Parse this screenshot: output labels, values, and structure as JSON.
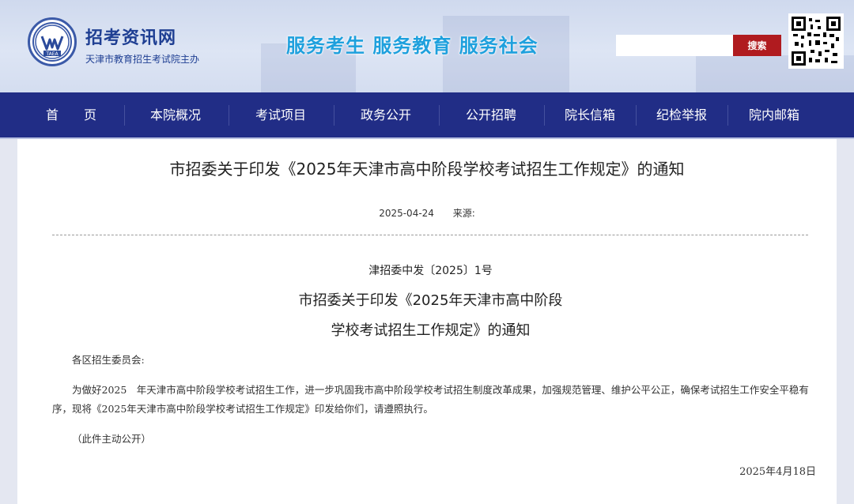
{
  "header": {
    "site_name": "招考资讯网",
    "host": "天津市教育招生考试院主办",
    "logo_text": "TAEA",
    "slogan": "服务考生  服务教育  服务社会",
    "search": {
      "placeholder": "",
      "button_label": "搜索"
    }
  },
  "nav": {
    "items": [
      {
        "label": "首　　页"
      },
      {
        "label": "本院概况"
      },
      {
        "label": "考试项目"
      },
      {
        "label": "政务公开"
      },
      {
        "label": "公开招聘"
      },
      {
        "label": "院长信箱"
      },
      {
        "label": "纪检举报"
      },
      {
        "label": "院内邮箱"
      }
    ]
  },
  "article": {
    "title": "市招委关于印发《2025年天津市高中阶段学校考试招生工作规定》的通知",
    "date": "2025-04-24",
    "source_label": "来源:",
    "doc_number": "津招委中发〔2025〕1号",
    "doc_title_line1": "市招委关于印发《2025年天津市高中阶段",
    "doc_title_line2": "学校考试招生工作规定》的通知",
    "salutation": "各区招生委员会:",
    "body": "为做好2025　年天津市高中阶段学校考试招生工作，进一步巩固我市高中阶段学校考试招生制度改革成果，加强规范管理、维护公平公正，确保考试招生工作安全平稳有序，现将《2025年天津市高中阶段学校考试招生工作规定》印发给你们，请遵照执行。",
    "disclosure": "（此件主动公开）",
    "signed_date": "2025年4月18日"
  },
  "colors": {
    "nav_bg": "#212d86",
    "brand_blue": "#1f3f93",
    "slogan": "#1ea0dd",
    "search_button": "#b01b1f"
  }
}
